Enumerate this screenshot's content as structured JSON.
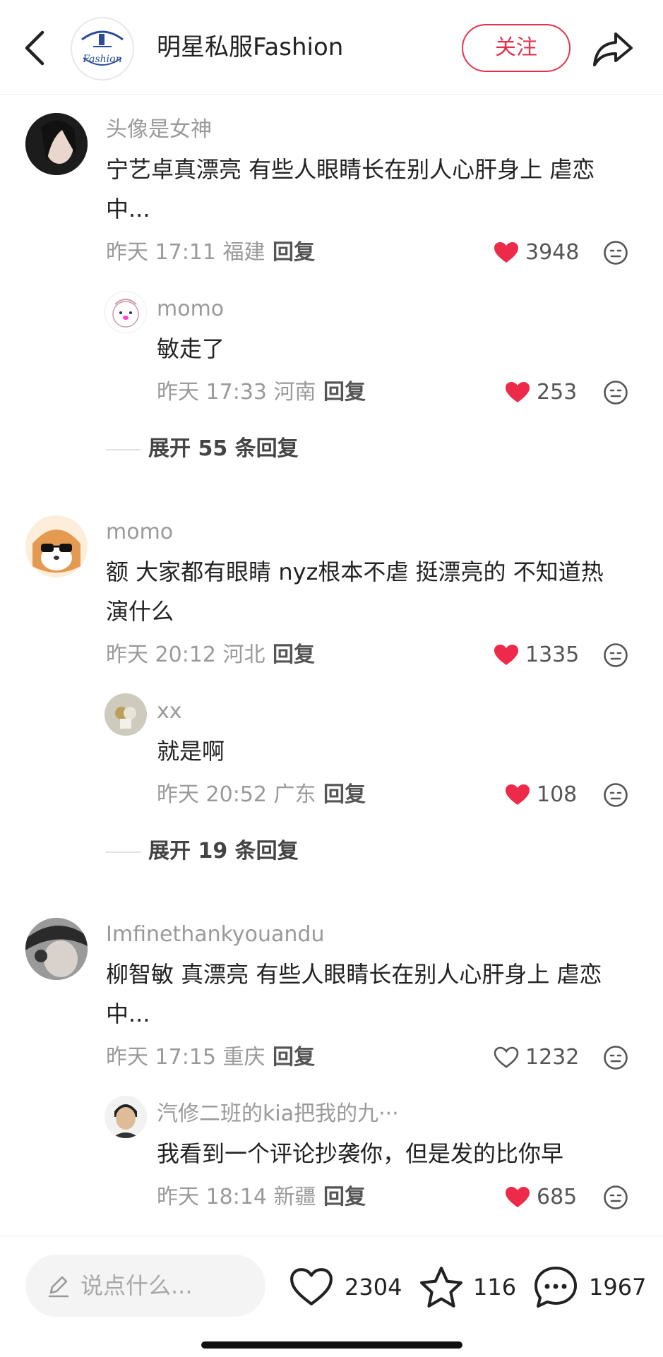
{
  "header": {
    "title": "明星私服Fashion",
    "follow_label": "关注",
    "logo_text": "Fashion"
  },
  "comments": [
    {
      "user": "头像是女神",
      "text_line1": "宁艺卓真漂亮 有些人眼睛长在别人心肝身上 虐恋",
      "text_line2": "中...",
      "time": "昨天 17:11 福建",
      "reply_label": "回复",
      "likes": "3948",
      "liked": true,
      "sub": {
        "user": "momo",
        "text": "敏走了",
        "time": "昨天 17:33 河南",
        "reply_label": "回复",
        "likes": "253",
        "liked": true
      },
      "expand": "展开 55 条回复"
    },
    {
      "user": "momo",
      "text_line1": "额 大家都有眼睛 nyz根本不虐 挺漂亮的 不知道热",
      "text_line2": "演什么",
      "time": "昨天 20:12 河北",
      "reply_label": "回复",
      "likes": "1335",
      "liked": true,
      "sub": {
        "user": "xx",
        "text": "就是啊",
        "time": "昨天 20:52 广东",
        "reply_label": "回复",
        "likes": "108",
        "liked": true
      },
      "expand": "展开 19 条回复"
    },
    {
      "user": "Imfinethankyouandu",
      "text_line1": "柳智敏 真漂亮 有些人眼睛长在别人心肝身上 虐恋",
      "text_line2": "中...",
      "time": "昨天 17:15 重庆",
      "reply_label": "回复",
      "likes": "1232",
      "liked": false,
      "sub": {
        "user": "汽修二班的kia把我的九···",
        "text": "我看到一个评论抄袭你，但是发的比你早",
        "time": "昨天 18:14 新疆",
        "reply_label": "回复",
        "likes": "685",
        "liked": true
      }
    }
  ],
  "bottombar": {
    "input_placeholder": "说点什么...",
    "like_count": "2304",
    "star_count": "116",
    "comment_count": "1967"
  },
  "colors": {
    "accent": "#e2334d",
    "heart": "#ee2a4a"
  }
}
